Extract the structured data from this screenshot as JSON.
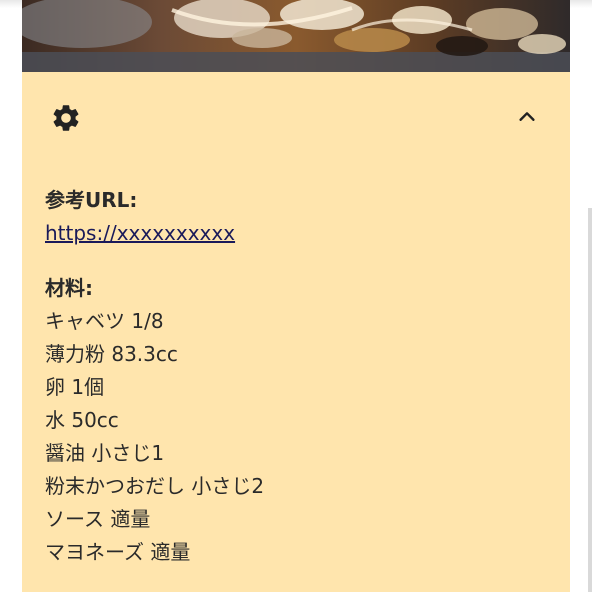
{
  "header": {
    "settings_icon": "gear-icon",
    "collapse_icon": "chevron-up-icon"
  },
  "details": {
    "url_label": "参考URL:",
    "url_value": "https://xxxxxxxxxx",
    "ingredients_label": "材料:",
    "ingredients": [
      "キャベツ 1/8",
      "薄力粉 83.3cc",
      "卵 1個",
      "水 50cc",
      "醤油 小さじ1",
      "粉末かつおだし 小さじ2",
      "ソース 適量",
      "マヨネーズ 適量"
    ]
  },
  "colors": {
    "card_background": "#ffe5ad",
    "text": "#2a2a2a",
    "link": "#1a1a5a"
  }
}
